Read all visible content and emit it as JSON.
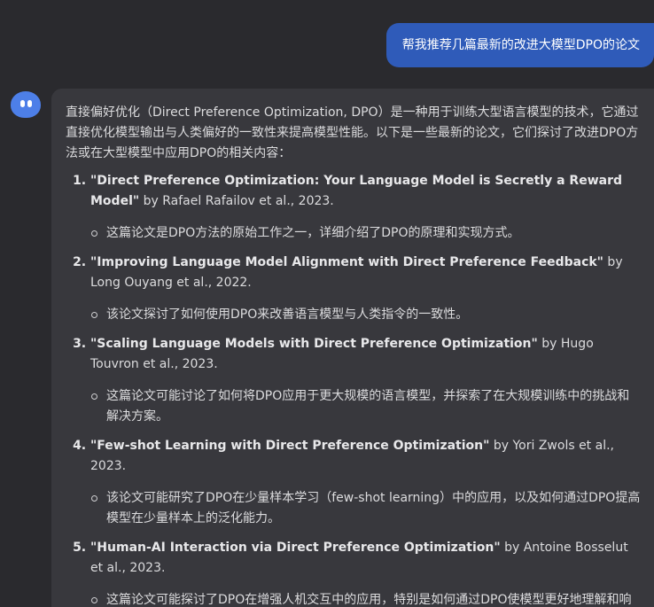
{
  "user_message": "帮我推荐几篇最新的改进大模型DPO的论文",
  "assistant": {
    "intro": "直接偏好优化（Direct Preference Optimization, DPO）是一种用于训练大型语言模型的技术，它通过直接优化模型输出与人类偏好的一致性来提高模型性能。以下是一些最新的论文，它们探讨了改进DPO方法或在大型模型中应用DPO的相关内容：",
    "papers": [
      {
        "title": "\"Direct Preference Optimization: Your Language Model is Secretly a Reward Model\"",
        "byline": " by Rafael Rafailov et al., 2023.",
        "note": "这篇论文是DPO方法的原始工作之一，详细介绍了DPO的原理和实现方式。"
      },
      {
        "title": "\"Improving Language Model Alignment with Direct Preference Feedback\"",
        "byline": " by Long Ouyang et al., 2022.",
        "note": "该论文探讨了如何使用DPO来改善语言模型与人类指令的一致性。"
      },
      {
        "title": "\"Scaling Language Models with Direct Preference Optimization\"",
        "byline": " by Hugo Touvron et al., 2023.",
        "note": "这篇论文可能讨论了如何将DPO应用于更大规模的语言模型，并探索了在大规模训练中的挑战和解决方案。"
      },
      {
        "title": "\"Few-shot Learning with Direct Preference Optimization\"",
        "byline": " by Yori Zwols et al., 2023.",
        "note": "该论文可能研究了DPO在少量样本学习（few-shot learning）中的应用，以及如何通过DPO提高模型在少量样本上的泛化能力。"
      },
      {
        "title": "\"Human-AI Interaction via Direct Preference Optimization\"",
        "byline": " by Antoine Bosselut et al., 2023.",
        "note": "这篇论文可能探讨了DPO在增强人机交互中的应用，特别是如何通过DPO使模型更好地理解和响应人类的指令和偏好。"
      }
    ]
  },
  "colors": {
    "background": "#2a2a2e",
    "user_bubble": "#2f5bb9",
    "assistant_bubble": "#38383d",
    "avatar": "#4d7fe8"
  },
  "icons": {
    "avatar": "assistant-avatar-icon"
  }
}
